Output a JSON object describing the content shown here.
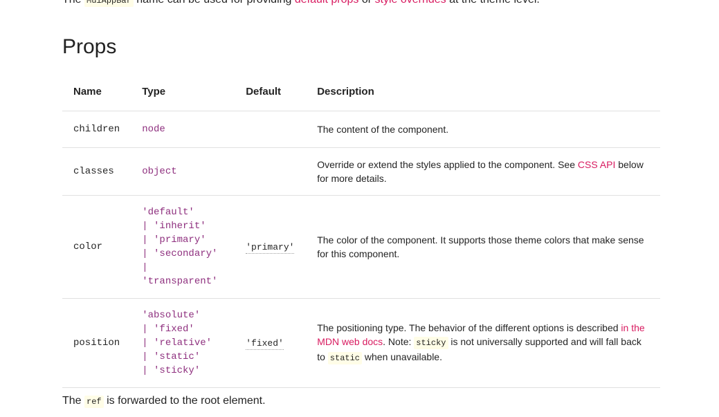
{
  "intro": {
    "prefix": "The ",
    "code": "MuiAppBar",
    "middle": " name can be used for providing ",
    "link1": "default props",
    "or": " or ",
    "link2": "style overrides",
    "suffix": " at the theme level."
  },
  "props_title": "Props",
  "table": {
    "headers": [
      "Name",
      "Type",
      "Default",
      "Description"
    ],
    "rows": [
      {
        "name": "children",
        "type_lines": [
          "node"
        ],
        "default": "",
        "description": "The content of the component."
      },
      {
        "name": "classes",
        "type_lines": [
          "object"
        ],
        "default": "",
        "description_pre": "Override or extend the styles applied to the component. See ",
        "description_link": "CSS API",
        "description_post": " below for more details."
      },
      {
        "name": "color",
        "type_lines": [
          "'default'",
          "| 'inherit'",
          "| 'primary'",
          "| 'secondary'",
          "| 'transparent'"
        ],
        "default": "'primary'",
        "description": "The color of the component. It supports those theme colors that make sense for this component."
      },
      {
        "name": "position",
        "type_lines": [
          "'absolute'",
          "| 'fixed'",
          "| 'relative'",
          "| 'static'",
          "| 'sticky'"
        ],
        "default": "'fixed'",
        "description_pre": "The positioning type. The behavior of the different options is described ",
        "description_link": "in the MDN web docs",
        "description_mid": ". Note: ",
        "description_code1": "sticky",
        "description_mid2": " is not universally supported and will fall back to ",
        "description_code2": "static",
        "description_post": " when unavailable."
      }
    ]
  },
  "footer": {
    "prefix": "The ",
    "code": "ref",
    "suffix": " is forwarded to the root element."
  },
  "colors": {
    "link": "#d81b60",
    "type_text": "#8e2f7e",
    "code_bg": "#fffde7",
    "divider": "#e0e0e0"
  }
}
